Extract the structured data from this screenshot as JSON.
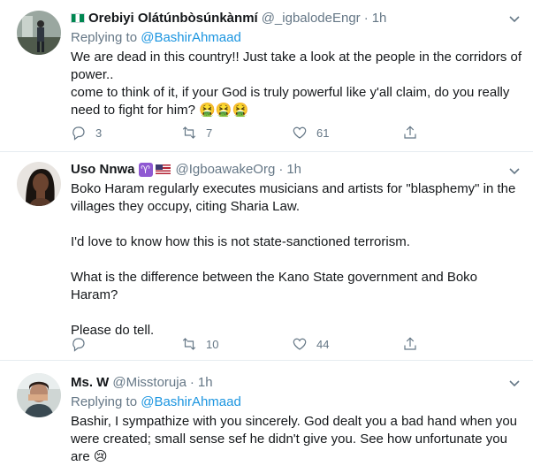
{
  "tweets": [
    {
      "name": "Orebiyi Olátúnbòsúnkànmí",
      "handle": "@_igbalodeEngr",
      "dot": "·",
      "time": "1h",
      "replying_prefix": "Replying to",
      "replying_to": "@BashirAhmaad",
      "body": [
        "We are dead in this country!! Just take a look at the people in the corridors of power..",
        "come to think of it, if your God is truly powerful like y'all claim, do you really need to fight for him?"
      ],
      "body_emoji": "🤮🤮🤮",
      "replies": "3",
      "retweets": "7",
      "likes": "61"
    },
    {
      "name": "Uso Nnwa",
      "handle": "@IgboawakeOrg",
      "dot": "·",
      "time": "1h",
      "aries_glyph": "♈",
      "body": [
        "Boko Haram regularly executes musicians and artists for \"blasphemy\" in the villages they occupy, citing Sharia Law.",
        "I'd love to know how this is not state-sanctioned terrorism.",
        "What is the difference between the Kano State government and Boko Haram?",
        "Please do tell."
      ],
      "replies": "",
      "retweets": "10",
      "likes": "44"
    },
    {
      "name": "Ms. W",
      "handle": "@Misstoruja",
      "dot": "·",
      "time": "1h",
      "replying_prefix": "Replying to",
      "replying_to": "@BashirAhmaad",
      "body": [
        "Bashir, I sympathize with you sincerely. God dealt you a bad hand when you were created; small sense sef he didn't give you. See how unfortunate you are"
      ],
      "body_emoji": "😢"
    }
  ],
  "colors": {
    "text": "#14171a",
    "muted": "#657786",
    "link": "#1b95e0",
    "divider": "#e6ecf0"
  },
  "icons": {
    "reply": "reply-icon",
    "retweet": "retweet-icon",
    "like": "heart-icon",
    "share": "share-icon",
    "more": "chevron-down-icon"
  }
}
